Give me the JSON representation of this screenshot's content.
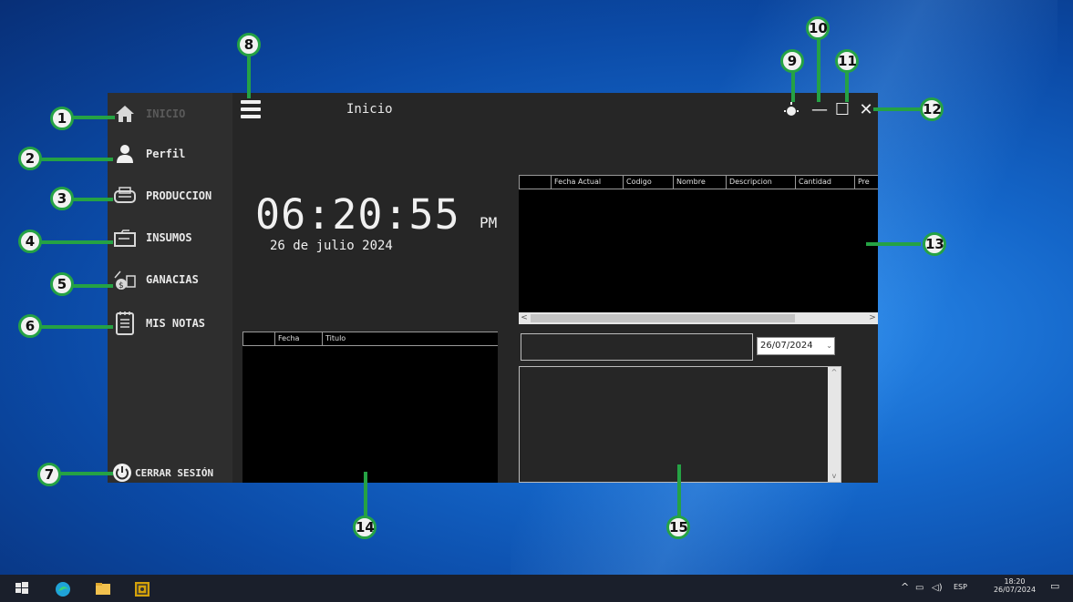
{
  "app": {
    "title": "Inicio",
    "nav": [
      {
        "label": "INICIO",
        "icon": "home-icon"
      },
      {
        "label": "Perfil",
        "icon": "user-icon"
      },
      {
        "label": "PRODUCCION",
        "icon": "printer-icon"
      },
      {
        "label": "INSUMOS",
        "icon": "folder-icon"
      },
      {
        "label": "GANACIAS",
        "icon": "money-icon"
      },
      {
        "label": "MIS NOTAS",
        "icon": "notepad-icon"
      }
    ],
    "logout_label": "CERRAR SESIÓN",
    "clock": {
      "time": "06:20:55",
      "ampm": "PM",
      "date": "26 de julio 2024"
    },
    "production_grid": {
      "columns": [
        "",
        "Fecha Actual",
        "Codigo",
        "Nombre",
        "Descripcion",
        "Cantidad",
        "Pre"
      ]
    },
    "notes_grid": {
      "columns": [
        "",
        "Fecha",
        "Titulo"
      ]
    },
    "note_date": "26/07/2024",
    "window_controls": {
      "theme": "sun-icon",
      "minimize": "—",
      "maximize": "☐",
      "close": "✕"
    }
  },
  "callouts": [
    "1",
    "2",
    "3",
    "4",
    "5",
    "6",
    "7",
    "8",
    "9",
    "10",
    "11",
    "12",
    "13",
    "14",
    "15"
  ],
  "taskbar": {
    "tray_lang": "ESP",
    "tray_time": "18:20",
    "tray_date": "26/07/2024"
  },
  "colors": {
    "accent": "#25a244",
    "app_bg": "#262626",
    "sidebar_bg": "#2e2e2e"
  }
}
